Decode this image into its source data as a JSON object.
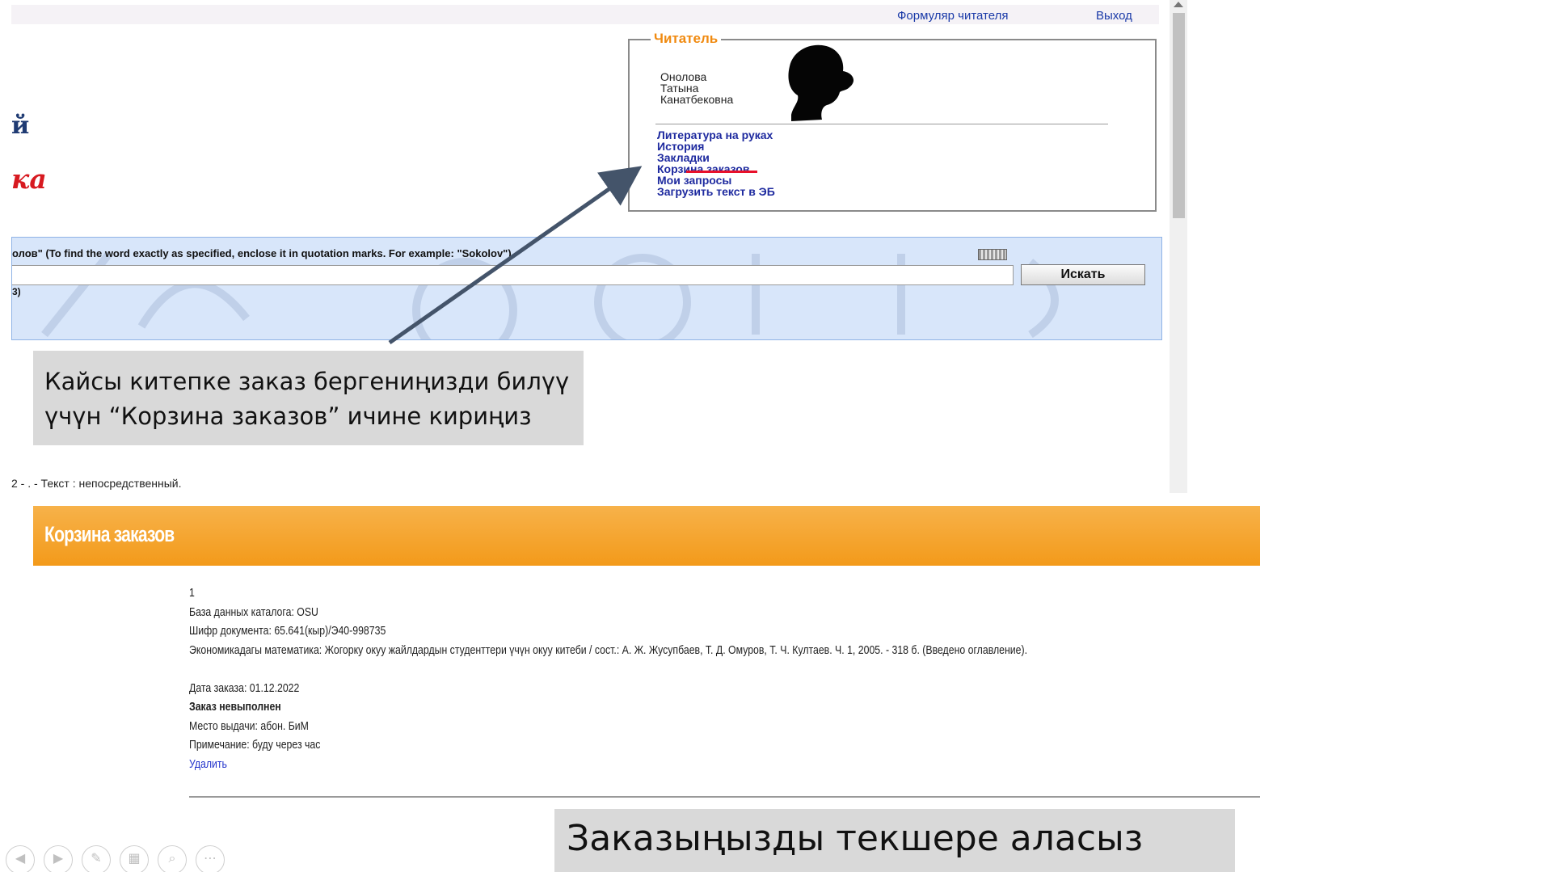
{
  "top_screenshot": {
    "header_links": {
      "reader_form": "Формуляр читателя",
      "logout": "Выход"
    },
    "logo": {
      "line1": "й",
      "line2": "ка"
    },
    "reader_panel": {
      "legend": "Читатель",
      "name_lines": [
        "Онолова",
        "Татына",
        "Канатбековна"
      ],
      "links": [
        "Литература на руках",
        "История",
        "Закладки",
        "Корзина заказов",
        "Мои запросы",
        "Загрузить текст в ЭБ"
      ]
    },
    "search": {
      "hint": "олов\" (To find the word exactly as specified, enclose it in quotation marks. For example: \"Sokolov\")",
      "hint2": "3)",
      "input_value": "",
      "button_label": "Искать"
    },
    "result_line": "2 - . - Текст : непосредственный."
  },
  "callout_top": {
    "line1": "Кайсы китепке заказ бергениңизди билүү",
    "line2": "үчүн “Корзина заказов”  ичине кириңиз"
  },
  "bottom_screenshot": {
    "title": "Корзина заказов",
    "order": {
      "number": "1",
      "catalog_db": "База данных каталога: OSU",
      "doc_code": "Шифр документа: 65.641(кыр)/Э40-998735",
      "description": "Экономикадагы математика: Жогорку окуу жайлдардын студенттери үчүн окуу китеби / сост.: А. Ж. Жусупбаев, Т. Д. Омуров, Т. Ч. Култаев. Ч. 1, 2005. - 318 б. (Введено оглавление).",
      "order_date": "Дата заказа: 01.12.2022",
      "status": "Заказ невыполнен",
      "pickup": "Место выдачи: абон. БиМ",
      "note": "Примечание: буду через час",
      "delete_label": "Удалить"
    }
  },
  "callout_bottom": {
    "text": "Заказыңызды текшере аласыз"
  },
  "slide_controls": [
    {
      "name": "previous-icon",
      "glyph": "◀"
    },
    {
      "name": "next-icon",
      "glyph": "▶"
    },
    {
      "name": "pen-icon",
      "glyph": "✎"
    },
    {
      "name": "slides-grid-icon",
      "glyph": "▦"
    },
    {
      "name": "zoom-icon",
      "glyph": "⌕"
    },
    {
      "name": "more-options-icon",
      "glyph": "⋯"
    }
  ],
  "colors": {
    "accent_orange": "#f39a1a",
    "link_blue": "#1e2a9f",
    "highlight_red": "#e8102a",
    "callout_gray": "#d9d9d9"
  }
}
